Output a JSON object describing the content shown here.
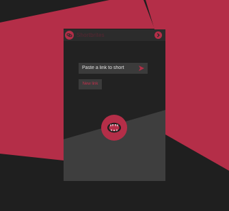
{
  "colors": {
    "accent": "#b42e48",
    "background": "#1f1f1f",
    "window": "#222222",
    "titlebar": "#2c2c2c",
    "field": "#3b3b3b",
    "lower_panel": "#3e3e3e"
  },
  "app": {
    "title": "Shortbrites",
    "icon": "chain-link-icon",
    "next_icon": "chevron-right-icon"
  },
  "shortener": {
    "placeholder": "Paste a link to short",
    "send_icon": "send-arrow-icon",
    "new_link_label": "New link"
  },
  "logo": {
    "icon": "fanged-mouth-icon"
  }
}
